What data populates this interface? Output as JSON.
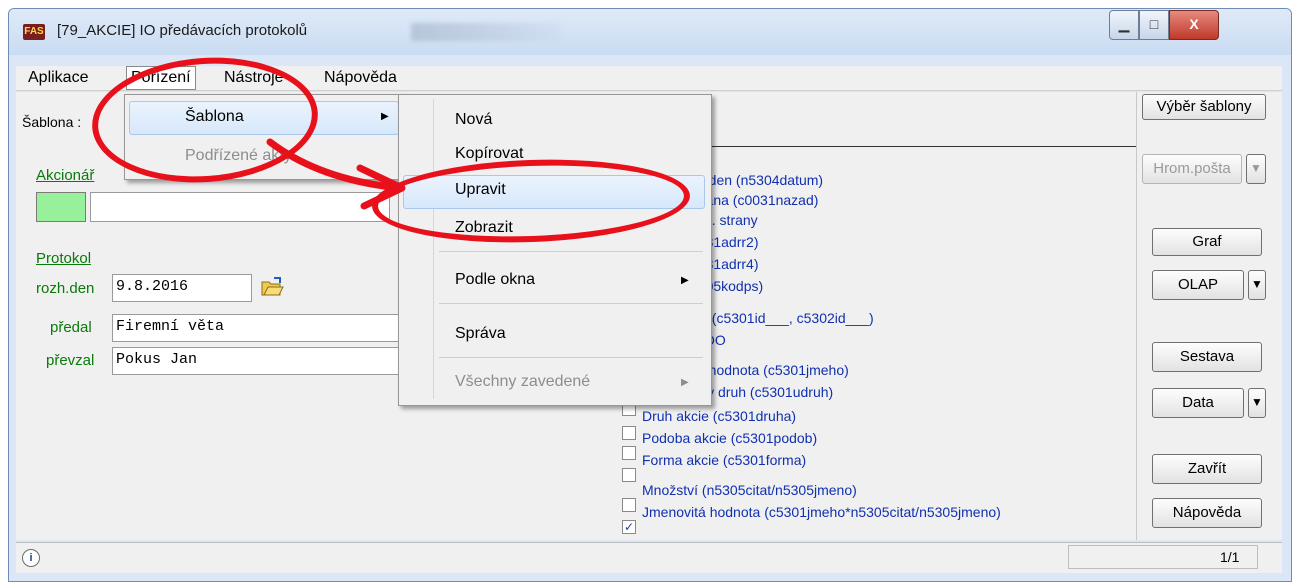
{
  "window": {
    "app_logo": "FAS",
    "title": "[79_AKCIE] IO předávacích protokolů",
    "minimize": "▁",
    "maximize": "□",
    "close": "X"
  },
  "menubar": {
    "items": [
      "Aplikace",
      "Pořízení",
      "Nástroje",
      "Nápověda"
    ]
  },
  "form": {
    "sablona_label": "Šablona :",
    "akcionar_label": "Akcionář",
    "protokol_label": "Protokol",
    "rozh_den_label": "rozh.den",
    "rozh_den_value": "9.8.2016",
    "predal_label": "předal",
    "predal_value": "Firemní věta",
    "prevzal_label": "převzal",
    "prevzal_value": "Pokus Jan"
  },
  "fields_list": {
    "items": [
      {
        "text": "ný den (n5304datum)",
        "checked": null
      },
      {
        "text": "strana (c0031nazad)",
        "checked": null
      },
      {
        "text": "sml. strany",
        "checked": null
      },
      {
        "text": "0031adrr2)",
        "checked": null
      },
      {
        "text": "0031adrr4)",
        "checked": null
      },
      {
        "text": "0005kodps)",
        "checked": null
      },
      {
        "text": "cie (c5301id___, c5302id___)",
        "checked": null
      },
      {
        "text": "D-DO",
        "checked": null
      },
      {
        "text": "itá hodnota (c5301jmeho)",
        "checked": null
      },
      {
        "text": "lský druh (c5301udruh)",
        "checked": false
      },
      {
        "text": "Druh akcie (c5301druha)",
        "checked": false
      },
      {
        "text": "Podoba akcie (c5301podob)",
        "checked": false
      },
      {
        "text": "Forma akcie (c5301forma)",
        "checked": false
      },
      {
        "text": "Množství (n5305citat/n5305jmeno)",
        "checked": false
      },
      {
        "text": "Jmenovitá hodnota (c5301jmeho*n5305citat/n5305jmeno)",
        "checked": true
      }
    ]
  },
  "right_panel": {
    "vyber_sablony": "Výběr šablony",
    "hrom_posta": "Hrom.pošta",
    "graf": "Graf",
    "olap": "OLAP",
    "sestava": "Sestava",
    "data": "Data",
    "zavrit": "Zavřít",
    "napoveda": "Nápověda"
  },
  "porizeni_menu": {
    "items": [
      "Šablona",
      "Podřízené akty"
    ]
  },
  "sablona_submenu": {
    "items": [
      "Nová",
      "Kopírovat",
      "Upravit",
      "Zobrazit",
      "Podle okna",
      "Správa",
      "Všechny zavedené"
    ]
  },
  "statusbar": {
    "info_icon": "i",
    "page": "1/1"
  },
  "annotation": {
    "color": "#e8101a"
  }
}
